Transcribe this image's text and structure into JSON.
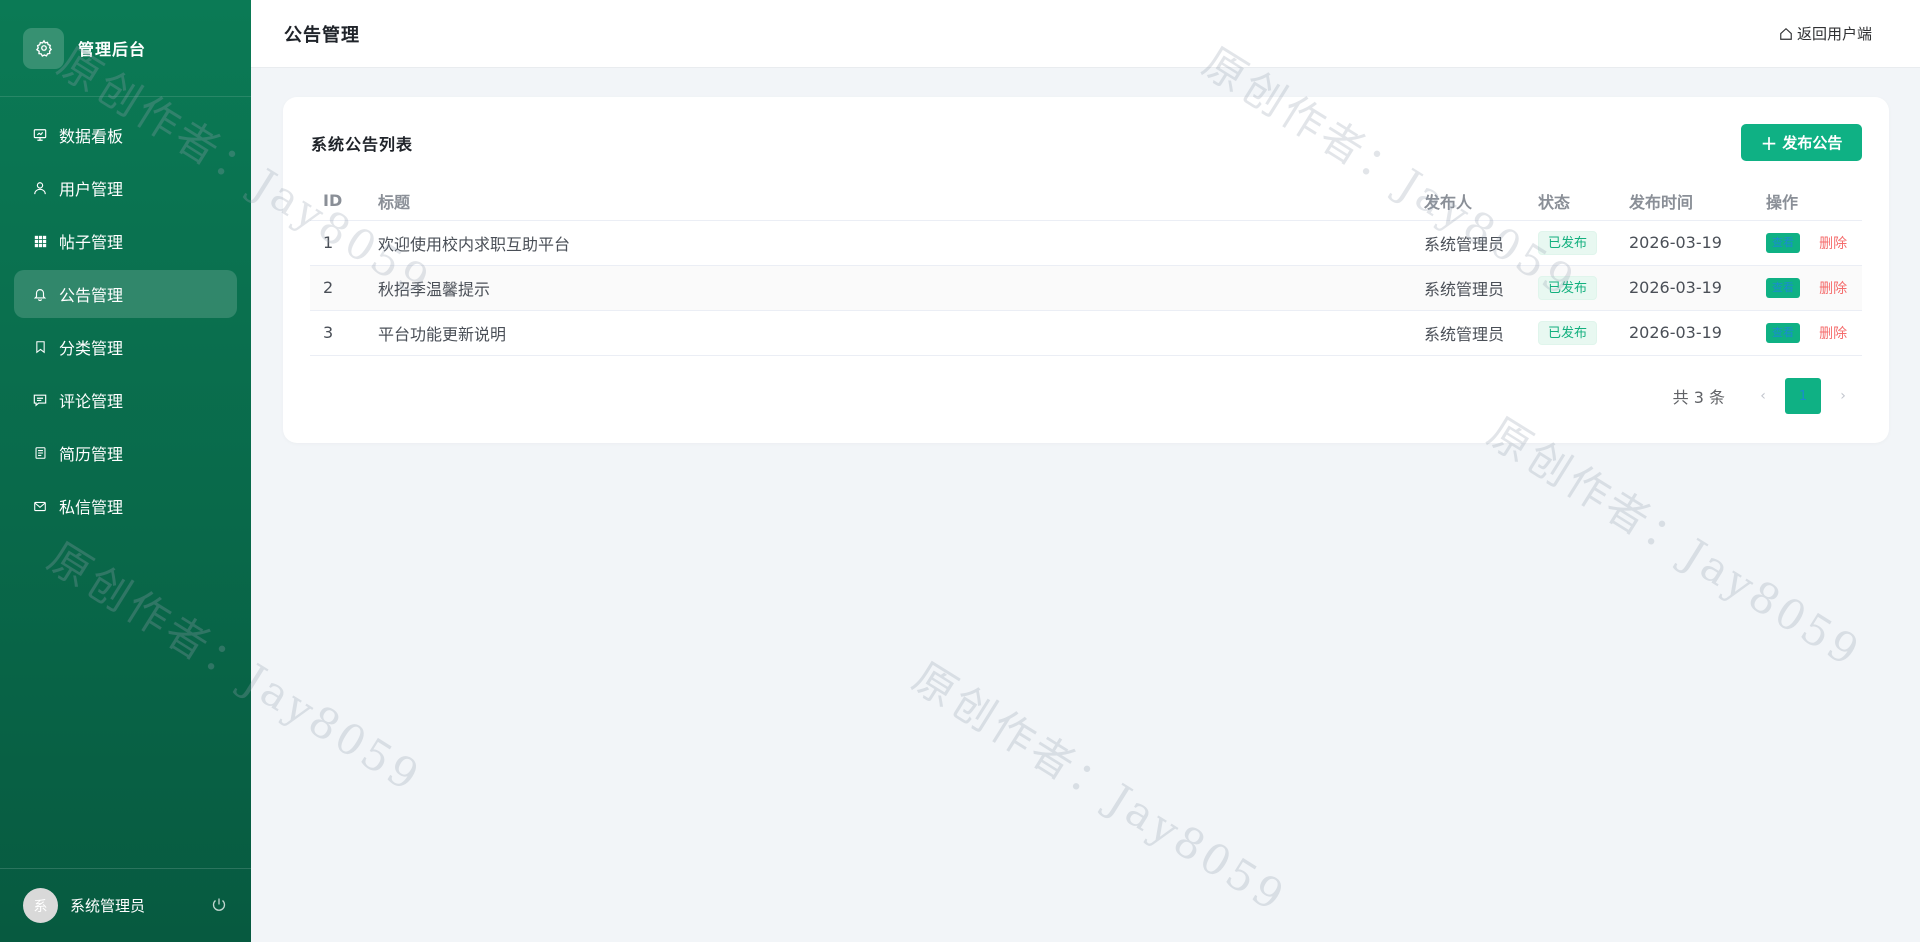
{
  "sidebar": {
    "brand_title": "管理后台",
    "items": [
      {
        "label": "数据看板",
        "icon": "dashboard-icon"
      },
      {
        "label": "用户管理",
        "icon": "user-icon"
      },
      {
        "label": "帖子管理",
        "icon": "grid-icon"
      },
      {
        "label": "公告管理",
        "icon": "bell-icon",
        "active": true
      },
      {
        "label": "分类管理",
        "icon": "bookmark-icon"
      },
      {
        "label": "评论管理",
        "icon": "comment-icon"
      },
      {
        "label": "简历管理",
        "icon": "document-icon"
      },
      {
        "label": "私信管理",
        "icon": "mail-icon"
      }
    ],
    "footer": {
      "avatar_text": "系",
      "username": "系统管理员"
    }
  },
  "header": {
    "title": "公告管理",
    "back_link": "返回用户端"
  },
  "card": {
    "title": "系统公告列表",
    "publish_button": "发布公告",
    "columns": [
      "ID",
      "标题",
      "发布人",
      "状态",
      "发布时间",
      "操作"
    ],
    "rows": [
      {
        "id": "1",
        "title": "欢迎使用校内求职互助平台",
        "publisher": "系统管理员",
        "status": "已发布",
        "time": "2026-03-19"
      },
      {
        "id": "2",
        "title": "秋招季温馨提示",
        "publisher": "系统管理员",
        "status": "已发布",
        "time": "2026-03-19"
      },
      {
        "id": "3",
        "title": "平台功能更新说明",
        "publisher": "系统管理员",
        "status": "已发布",
        "time": "2026-03-19"
      }
    ],
    "actions": {
      "view": "查看",
      "delete": "删除"
    },
    "pagination": {
      "total_text": "共 3 条",
      "current_page": "1"
    }
  },
  "watermark": "原创作者：Jay8059",
  "colors": {
    "sidebar": "#0b7a55",
    "accent": "#0fb184",
    "danger": "#f56c6c",
    "background": "#f2f5f8"
  }
}
